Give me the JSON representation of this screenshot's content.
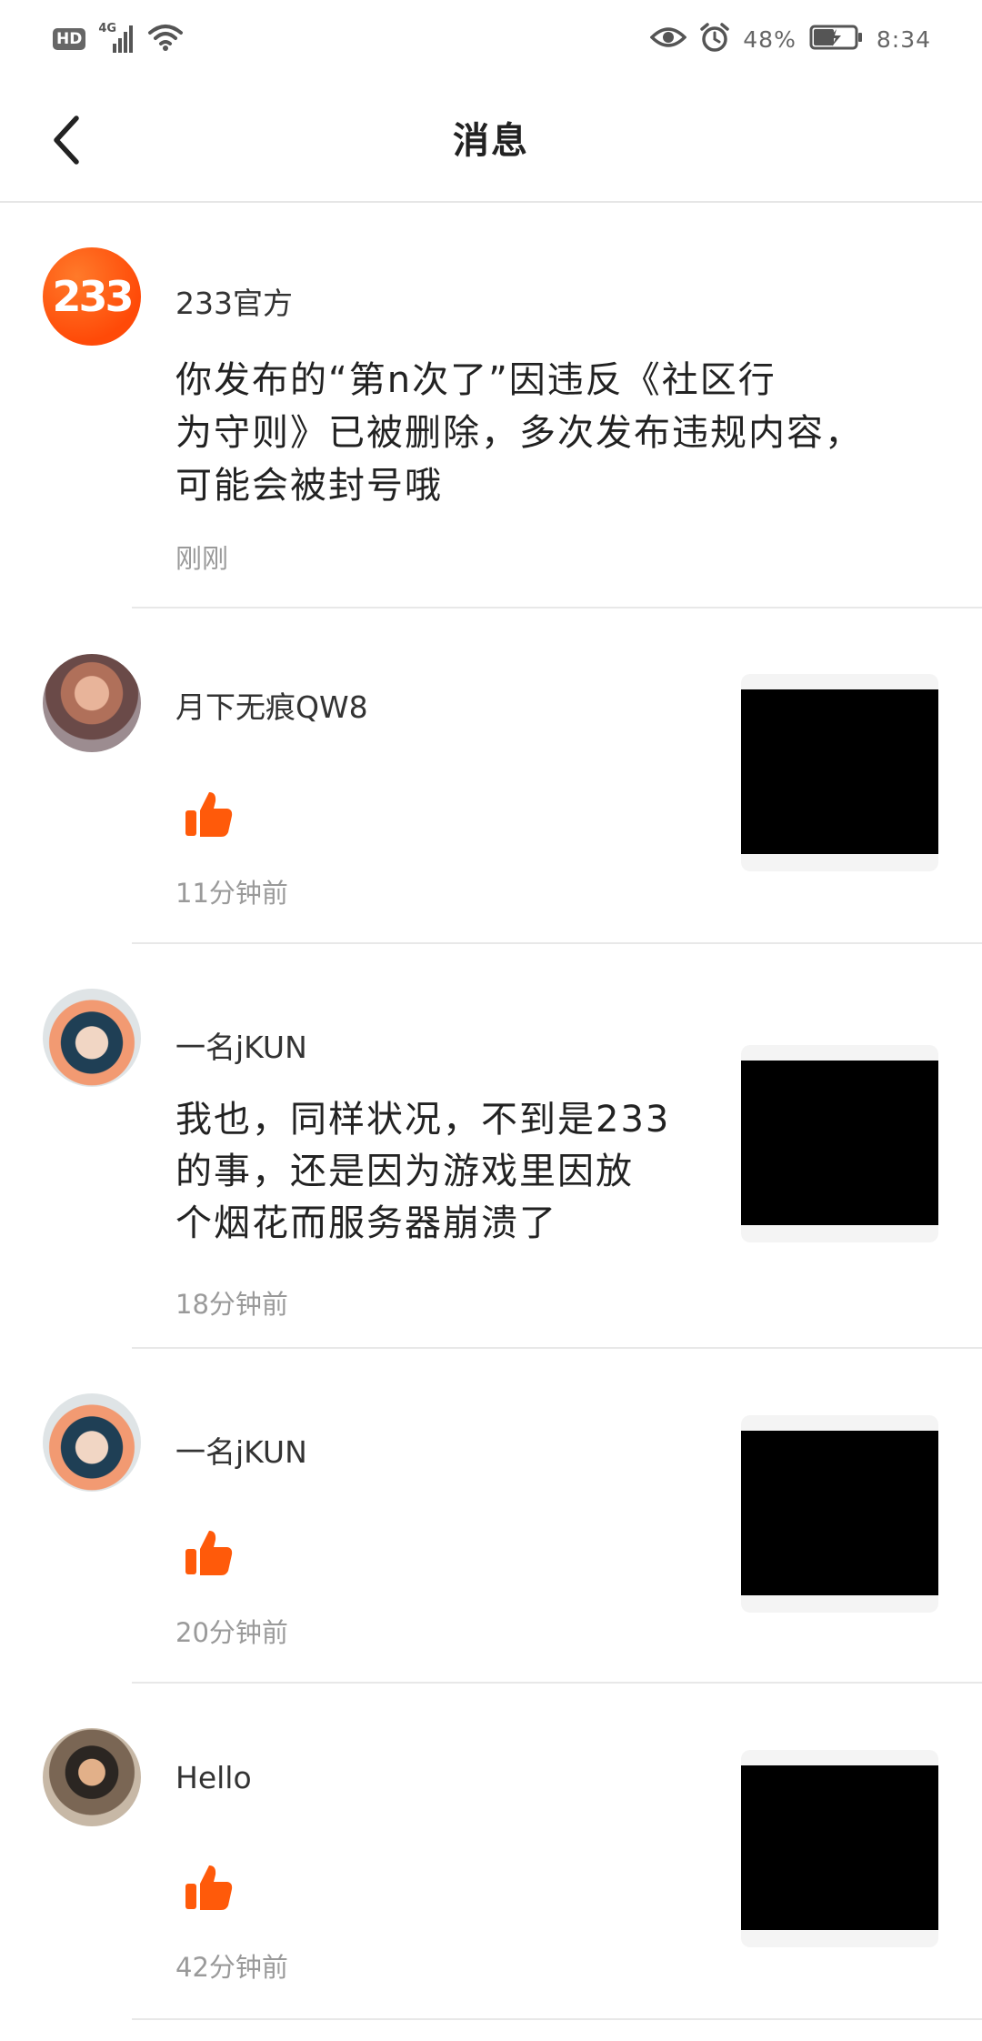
{
  "status_bar": {
    "hd": "HD",
    "network": "4G",
    "battery_percent": "48%",
    "time": "8:34",
    "icons": [
      "hd-icon",
      "signal-icon",
      "wifi-icon",
      "eye-icon",
      "alarm-icon",
      "battery-charging-icon"
    ]
  },
  "header": {
    "title": "消息",
    "back_icon": "chevron-left-icon"
  },
  "colors": {
    "accent": "#ff5a0a",
    "divider": "#e8e8e8",
    "timestamp": "#9a9a9a"
  },
  "messages": [
    {
      "user": "233官方",
      "type": "system",
      "text_lines": [
        "你发布的“第n次了”因违反《社区行",
        "为守则》已被删除，多次发布违规内容，",
        "可能会被封号哦"
      ],
      "time": "刚刚"
    },
    {
      "user": "月下无痕QW8",
      "type": "like",
      "time": "11分钟前"
    },
    {
      "user": "一名jKUN",
      "type": "comment",
      "text_lines": [
        "我也，同样状况，不到是233",
        "的事，还是因为游戏里因放",
        "个烟花而服务器崩溃了"
      ],
      "time": "18分钟前"
    },
    {
      "user": "一名jKUN",
      "type": "like",
      "time": "20分钟前"
    },
    {
      "user": "Hello",
      "type": "like",
      "time": "42分钟前"
    }
  ]
}
